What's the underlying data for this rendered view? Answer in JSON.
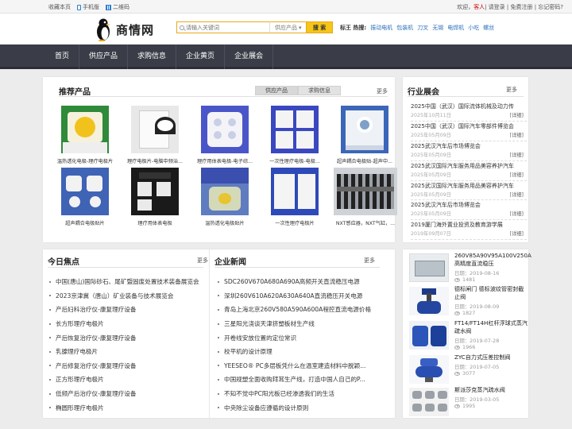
{
  "topbar": {
    "bookmark": "收藏本页",
    "mobile": "手机版",
    "qrcode": "二维码",
    "welcome": "欢迎，",
    "guest": "客人",
    "login": "| 请登录 | 免费注册 | 忘记密码?"
  },
  "logo": {
    "text": "商情网"
  },
  "search": {
    "placeholder": "请输入关键词",
    "category": "供应产品",
    "button": "搜 索"
  },
  "hot": {
    "label": "标王 热搜:",
    "keywords": [
      "振动电机",
      "包装机",
      "刀叉",
      "无锡",
      "电焊机",
      "小吃",
      "螺丝"
    ]
  },
  "nav": [
    "首页",
    "供应产品",
    "求购信息",
    "企业黄页",
    "企业展会"
  ],
  "recommended": {
    "title": "推荐产品",
    "tabs": [
      "供应产品",
      "求购信息"
    ],
    "more": "更多",
    "products": [
      "温热透化电极-理疗电极片",
      "理疗电极片-电脑中频治...",
      "理疗用体表电极-电子综...",
      "一次性理疗电极-电极...",
      "超声耦合电极贴-超声中...",
      "超声耦合电极贴片",
      "理疗用体表电极",
      "温热透化电极贴片",
      "一次性理疗电极片",
      "NXT感应器，NXT气缸，..."
    ]
  },
  "expo": {
    "title": "行业展会",
    "more": "更多",
    "items": [
      {
        "title": "2025中国（武汉）国际流体机械及动力传",
        "date": "2025年10月11日"
      },
      {
        "title": "2025中国（武汉）国际汽车零部件博览会",
        "date": "2025年05月09日"
      },
      {
        "title": "2025武汉汽车后市场博览会",
        "date": "2025年05月09日"
      },
      {
        "title": "2025武汉国际汽车服务用品美容养护汽车",
        "date": "2025年05月09日"
      },
      {
        "title": "2025武汉国际汽车服务用品美容养护汽车",
        "date": "2025年05月09日"
      },
      {
        "title": "2025武汉汽车后市场博览会",
        "date": "2025年05月09日"
      },
      {
        "title": "2019厦门海外置业投资及教育游学展",
        "date": "2019年09月07日"
      }
    ],
    "detail": "[详细]"
  },
  "focus": {
    "title": "今日焦点",
    "more": "更多",
    "items": [
      "中国(唐山)国际砂石、尾矿暨固废处置技术装备展览会",
      "2023京津冀（唐山）矿业装备与技术展览会",
      "产后妇科治疗仪-康复理疗设备",
      "长方形理疗电极片",
      "产后恢复治疗仪-康复理疗设备",
      "乳腺理疗电极片",
      "产后修复治疗仪-康复理疗设备",
      "正方形理疗电极片",
      "低频产后治疗仪-康复理疗设备",
      "椭圆形理疗电极片"
    ]
  },
  "news": {
    "title": "企业新闻",
    "more": "更多",
    "items": [
      "SDC260V670A680A690A高频开关直流稳压电源",
      "深圳260V610A620A630A640A直流稳压开关电源",
      "青岛上海北京260V580A590A600A程控直流电源价格",
      "三星阳光浇谈天津挤塑板材生产线",
      "开卷线安放位置的定位常识",
      "校平机的设计原理",
      "YEESEO® PC多层板凭什么在温室建造材料中脱颖...",
      "中国规塑全面收购拜耳生产线，打造中国人自己的P...",
      "不知不觉中PC阳光板已经渗透我们的生活",
      "中央除尘设备应遵循的设计原则"
    ]
  },
  "side_products": [
    {
      "title": "260V85A90V95A100V250A高精度直流稳压",
      "date": "日期：2019-08-16",
      "views": "1481"
    },
    {
      "title": "德标闸门 德标波纹管密封截止阀",
      "date": "日期：2019-08-09",
      "views": "1827"
    },
    {
      "title": "FT14/FT14H杠杆浮球式蒸汽疏水阀",
      "date": "日期：2019-07-28",
      "views": "1966"
    },
    {
      "title": "ZYC自力式压差控制阀",
      "date": "日期：2019-07-05",
      "views": "3077"
    },
    {
      "title": "斯派莎克蒸汽疏水阀",
      "date": "日期：2019-03-05",
      "views": "1995"
    }
  ]
}
